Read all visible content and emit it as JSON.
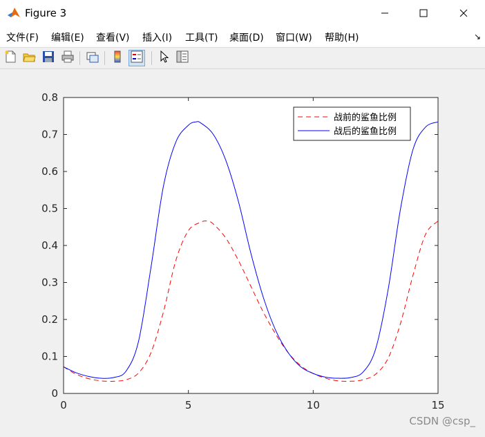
{
  "window": {
    "title": "Figure 3",
    "icon": "matlab-icon",
    "controls": [
      "minimize-icon",
      "maximize-icon",
      "close-icon"
    ]
  },
  "menu": {
    "items": [
      {
        "label": "文件(F)"
      },
      {
        "label": "编辑(E)"
      },
      {
        "label": "查看(V)"
      },
      {
        "label": "插入(I)"
      },
      {
        "label": "工具(T)"
      },
      {
        "label": "桌面(D)"
      },
      {
        "label": "窗口(W)"
      },
      {
        "label": "帮助(H)"
      }
    ]
  },
  "toolbar": {
    "buttons": [
      {
        "icon": "new-figure-icon"
      },
      {
        "icon": "open-file-icon"
      },
      {
        "icon": "save-icon"
      },
      {
        "icon": "print-icon"
      },
      {
        "icon": "link-figure-icon"
      },
      {
        "icon": "colorbar-icon"
      },
      {
        "icon": "legend-icon",
        "active": true
      },
      {
        "icon": "pointer-icon"
      },
      {
        "icon": "property-editor-icon"
      }
    ]
  },
  "chart_data": {
    "type": "line",
    "xlim": [
      0,
      15
    ],
    "ylim": [
      0,
      0.8
    ],
    "xticks": [
      "0",
      "5",
      "10",
      "15"
    ],
    "yticks": [
      "0",
      "0.1",
      "0.2",
      "0.3",
      "0.4",
      "0.5",
      "0.6",
      "0.7",
      "0.8"
    ],
    "grid": false,
    "legend_position": "top-right",
    "series": [
      {
        "name": "战前的鲨鱼比例",
        "color": "#ff0000",
        "style": "dashed",
        "x": [
          0,
          0.5,
          1,
          1.5,
          2,
          2.5,
          3,
          3.5,
          4,
          4.5,
          5,
          5.5,
          5.75,
          6,
          6.5,
          7,
          7.5,
          8,
          8.5,
          9,
          9.5,
          10,
          10.5,
          11,
          11.5,
          12,
          12.5,
          13,
          13.5,
          14,
          14.5,
          15
        ],
        "y": [
          0.072,
          0.052,
          0.04,
          0.034,
          0.033,
          0.037,
          0.055,
          0.11,
          0.22,
          0.36,
          0.44,
          0.463,
          0.466,
          0.458,
          0.42,
          0.36,
          0.29,
          0.22,
          0.16,
          0.11,
          0.075,
          0.054,
          0.041,
          0.034,
          0.033,
          0.037,
          0.052,
          0.095,
          0.19,
          0.32,
          0.43,
          0.466
        ]
      },
      {
        "name": "战后的鲨鱼比例",
        "color": "#0000ff",
        "style": "solid",
        "x": [
          0,
          0.5,
          1,
          1.5,
          2,
          2.5,
          3,
          3.5,
          4,
          4.5,
          5,
          5.3,
          5.5,
          6,
          6.5,
          7,
          7.5,
          8,
          8.5,
          9,
          9.5,
          10,
          10.5,
          11,
          11.5,
          12,
          12.5,
          13,
          13.5,
          14,
          14.5,
          15
        ],
        "y": [
          0.072,
          0.056,
          0.046,
          0.041,
          0.043,
          0.06,
          0.14,
          0.34,
          0.56,
          0.68,
          0.725,
          0.734,
          0.731,
          0.7,
          0.63,
          0.52,
          0.38,
          0.26,
          0.17,
          0.11,
          0.072,
          0.054,
          0.044,
          0.041,
          0.043,
          0.058,
          0.12,
          0.28,
          0.5,
          0.66,
          0.72,
          0.734
        ]
      }
    ]
  },
  "watermark": "CSDN @csp_"
}
